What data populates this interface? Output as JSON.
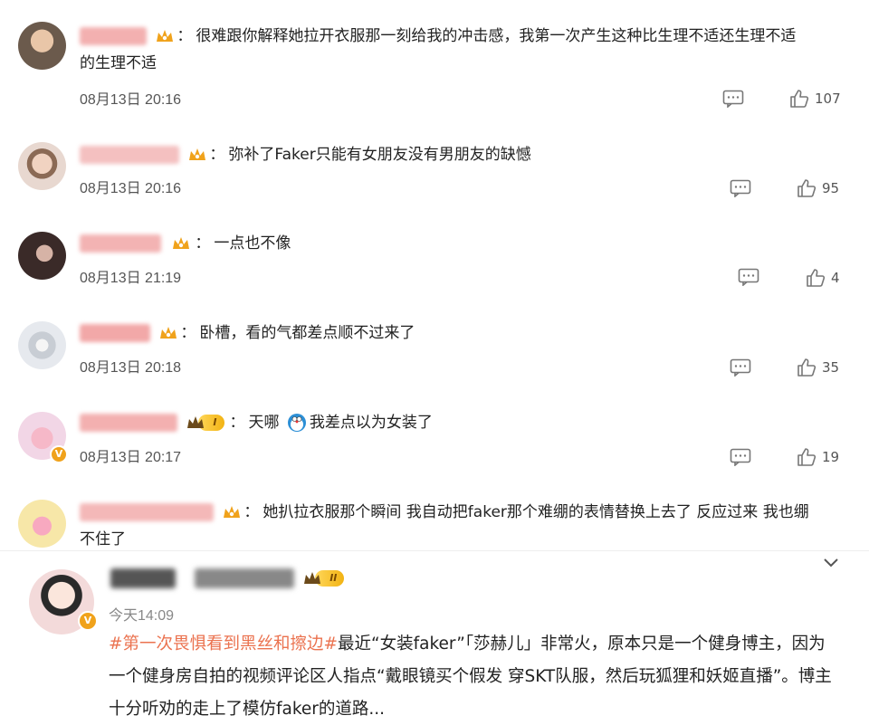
{
  "comments": [
    {
      "text_line1": "很难跟你解释她拉开衣服那一刻给我的冲击感，我第一次产生这种比生理不适还生理不适",
      "text_line2": "的生理不适",
      "time": "08月13日 20:16",
      "likes": "107",
      "colors": {
        "avatar": "#6b5a4c",
        "name": "#f0a0a0"
      }
    },
    {
      "text_line1": "弥补了Faker只能有女朋友没有男朋友的缺憾",
      "time": "08月13日 20:16",
      "likes": "95",
      "colors": {
        "avatar": "#e8d2c6",
        "name": "#f3b5b5"
      }
    },
    {
      "text_line1": "一点也不像",
      "time": "08月13日 21:19",
      "likes": "4",
      "colors": {
        "avatar": "#3a2a28",
        "name": "#f2a8a8"
      }
    },
    {
      "text_line1": "卧槽，看的气都差点顺不过来了",
      "time": "08月13日 20:18",
      "likes": "35",
      "colors": {
        "avatar": "#d9dee6",
        "name": "#f2a4a4"
      }
    },
    {
      "text_line1": "天哪",
      "text_after_emoji": "我差点以为女装了",
      "time": "08月13日 20:17",
      "likes": "19",
      "badge_level": "I",
      "colors": {
        "avatar": "#f2d6e6",
        "name": "#f1a1a1"
      }
    },
    {
      "text_line1": "她扒拉衣服那个瞬间 我自动把faker那个难绷的表情替换上去了 反应过来 我也绷",
      "text_line2": "不住了",
      "colors": {
        "avatar": "#f7e7a8",
        "name": "#f4b0b0"
      }
    }
  ],
  "post": {
    "time": "今天14:09",
    "hashtag": "#第一次畏惧看到黑丝和擦边#",
    "text": "最近“女装faker”「莎赫儿」非常火，原本只是一个健身博主，因为一个健身房自拍的视频评论区人指点“戴眼镜买个假发 穿SKT队服，然后玩狐狸和妖姬直播”。博主十分听劝的走上了模仿faker的道路...",
    "badge_level": "II"
  },
  "icons": {
    "reply": "comment-icon",
    "like": "thumbs-up-icon",
    "crown": "crown-icon",
    "chevron": "chevron-down-icon"
  },
  "colors": {
    "hashtag": "#eb7350",
    "crown": "#f0a21b",
    "text": "#222222",
    "meta": "#555555"
  }
}
